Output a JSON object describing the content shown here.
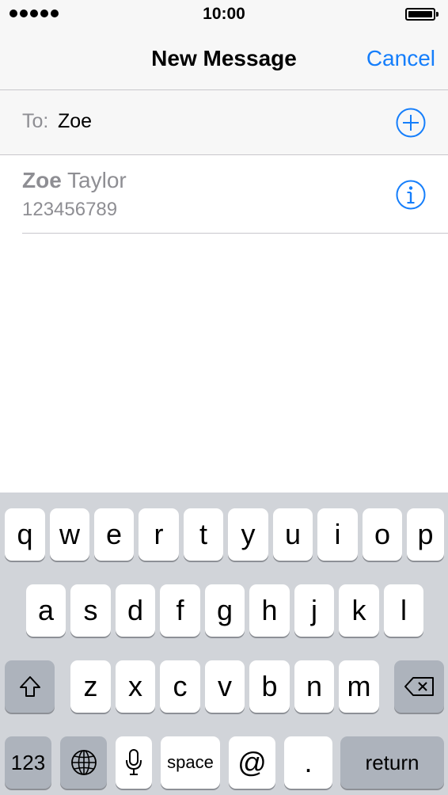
{
  "status_bar": {
    "time": "10:00",
    "signal_icon": "signal-dots-icon",
    "battery_icon": "battery-icon"
  },
  "nav": {
    "title": "New Message",
    "cancel_label": "Cancel"
  },
  "to_field": {
    "label": "To:",
    "value": "Zoe",
    "add_icon": "plus-circle-icon"
  },
  "suggestion": {
    "name_match": "Zoe",
    "name_rest": " Taylor",
    "number": "123456789",
    "info_icon": "info-circle-icon"
  },
  "keyboard": {
    "row1": [
      "q",
      "w",
      "e",
      "r",
      "t",
      "y",
      "u",
      "i",
      "o",
      "p"
    ],
    "row2": [
      "a",
      "s",
      "d",
      "f",
      "g",
      "h",
      "j",
      "k",
      "l"
    ],
    "row3": [
      "z",
      "x",
      "c",
      "v",
      "b",
      "n",
      "m"
    ],
    "numbers_label": "123",
    "space_label": "space",
    "at_label": "@",
    "dot_label": ".",
    "return_label": "return",
    "shift_icon": "shift-icon",
    "delete_icon": "backspace-icon",
    "globe_icon": "globe-icon",
    "mic_icon": "microphone-icon"
  },
  "colors": {
    "accent": "#157efb",
    "secondary_text": "#8e8e93",
    "keyboard_bg": "#d1d4d9",
    "dark_key": "#adb3bc"
  }
}
